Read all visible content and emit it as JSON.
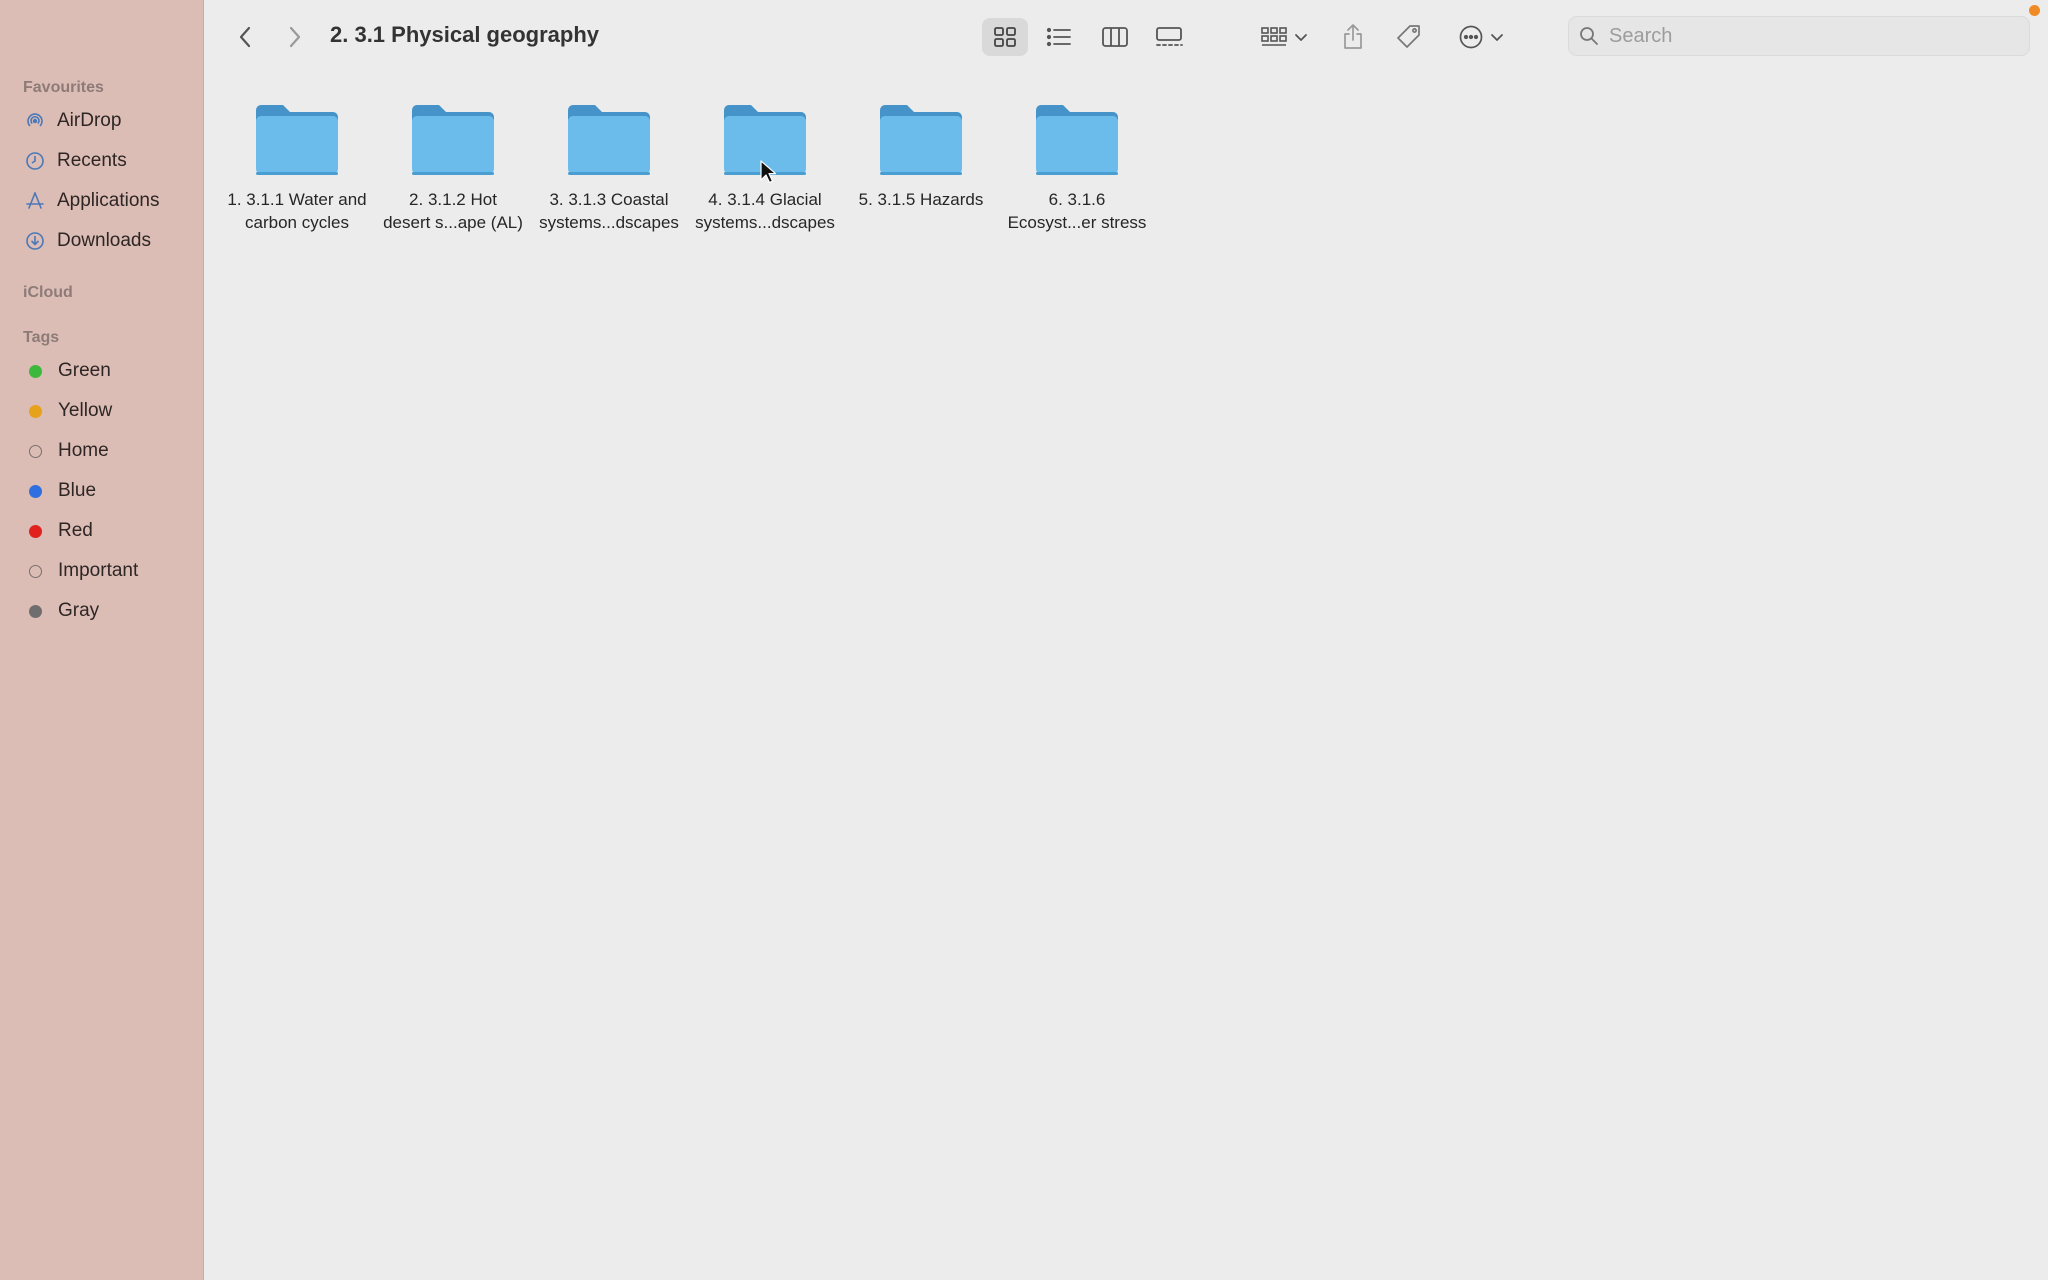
{
  "window": {
    "title": "2. 3.1 Physical geography"
  },
  "sidebar": {
    "favourites_heading": "Favourites",
    "favourites": [
      {
        "label": "AirDrop",
        "icon": "airdrop-icon"
      },
      {
        "label": "Recents",
        "icon": "clock-icon"
      },
      {
        "label": "Applications",
        "icon": "applications-icon"
      },
      {
        "label": "Downloads",
        "icon": "download-icon"
      }
    ],
    "icloud_heading": "iCloud",
    "tags_heading": "Tags",
    "tags": [
      {
        "label": "Green",
        "color": "#3cb93c"
      },
      {
        "label": "Yellow",
        "color": "#e7a21c"
      },
      {
        "label": "Home",
        "color": ""
      },
      {
        "label": "Blue",
        "color": "#2f6fe0"
      },
      {
        "label": "Red",
        "color": "#e0211e"
      },
      {
        "label": "Important",
        "color": ""
      },
      {
        "label": "Gray",
        "color": "#6e6e6e"
      }
    ]
  },
  "toolbar": {
    "search_placeholder": "Search",
    "accent": "#5ea9dd"
  },
  "folders": [
    {
      "line1": "1. 3.1.1 Water and",
      "line2": "carbon cycles"
    },
    {
      "line1": "2. 3.1.2 Hot",
      "line2": "desert s...ape (AL)"
    },
    {
      "line1": "3. 3.1.3 Coastal",
      "line2": "systems...dscapes"
    },
    {
      "line1": "4. 3.1.4 Glacial",
      "line2": "systems...dscapes"
    },
    {
      "line1": "5. 3.1.5 Hazards",
      "line2": ""
    },
    {
      "line1": "6. 3.1.6",
      "line2": "Ecosyst...er stress"
    }
  ]
}
